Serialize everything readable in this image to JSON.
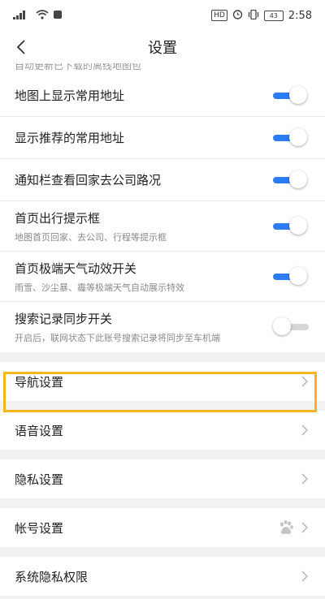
{
  "status_bar": {
    "left_signal": "4G",
    "hd_label": "HD",
    "battery": "43",
    "time": "2:58"
  },
  "header": {
    "title": "设置"
  },
  "scroll": {
    "partial_text": "自动更新已下载的离线地图包"
  },
  "toggle_rows": [
    {
      "label": "地图上显示常用地址",
      "sub": "",
      "on": true
    },
    {
      "label": "显示推荐的常用地址",
      "sub": "",
      "on": true
    },
    {
      "label": "通知栏查看回家去公司路况",
      "sub": "",
      "on": true
    },
    {
      "label": "首页出行提示框",
      "sub": "地图首页回家、去公司、行程等提示框",
      "on": true
    },
    {
      "label": "首页极端天气动效开关",
      "sub": "雨雪、沙尘暴、霾等极端天气自动展示特效",
      "on": true
    },
    {
      "label": "搜索记录同步开关",
      "sub": "开启后，联网状态下此账号搜索记录将同步至车机端",
      "on": false
    }
  ],
  "nav_rows": [
    {
      "label": "导航设置",
      "highlighted": true
    },
    {
      "label": "语音设置"
    },
    {
      "label": "隐私设置"
    },
    {
      "label": "帐号设置",
      "icon": "baidu-paw-icon"
    },
    {
      "label": "系统隐私权限"
    }
  ],
  "colors": {
    "accent": "#2d7cf6",
    "highlight": "#f6b51c"
  }
}
